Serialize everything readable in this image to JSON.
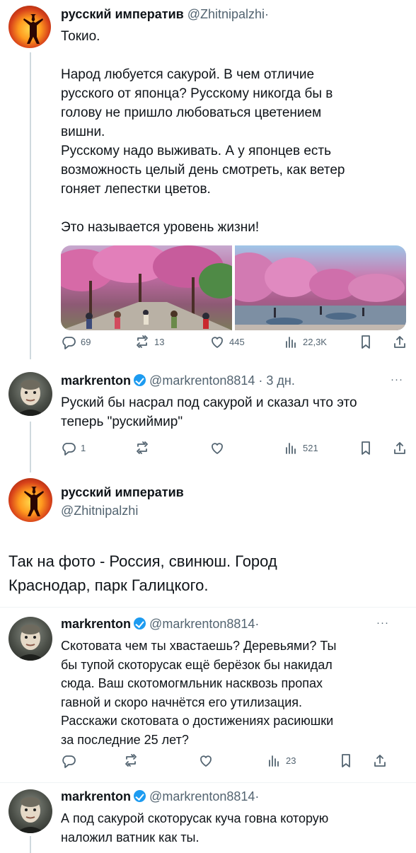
{
  "tweet1": {
    "author": "русский император",
    "author_display": "русский императив",
    "handle": "@Zhitnipalzhi",
    "dot": "·",
    "text": "Токио.\n\nНарод любуется сакурой. В чем отличие\nрусского от японца? Русскому никогда бы в\nголову не пришло любоваться цветением\nвишни.\nРусскому надо выживать. А у японцев есть\nвозможность целый день смотреть, как ветер\nгоняет лепестки цветов.\n\nЭто называется уровень жизни!",
    "replies": "69",
    "reposts": "13",
    "likes": "445",
    "views": "22,3K",
    "colors": {
      "sky": "#9fc6e8",
      "blossom": "#d77fb5"
    }
  },
  "tweet2": {
    "author": "markrenton",
    "handle": "@markrenton8814",
    "time": "· 3 дн.",
    "more": "···",
    "text": "Руский бы насрал под сакурой и сказал что это\nтеперь \"рускиймир\"",
    "replies": "1",
    "views": "521"
  },
  "tweet3": {
    "author": "русский императив",
    "handle": "@Zhitnipalzhi",
    "text": "Так на фото - Россия, свинюш. Город\nКраснодар, парк Галицкого."
  },
  "tweet4": {
    "author": "markrenton",
    "handle": "@markrenton8814",
    "dot": "·",
    "more": "···",
    "text": "Скотовата чем ты хвастаешь?  Деревьями? Ты\nбы тупой скоторусак ещё берёзок бы накидал\nсюда. Ваш скотомогмльник насквозь пропах\nгавной и скоро начнётся его утилизация.\nРасскажи скотовата о достижениях расиюшки\nза последние 25 лет?",
    "views": "23"
  },
  "tweet5": {
    "author": "markrenton",
    "handle": "@markrenton8814",
    "dot": "·",
    "text": "А под сакурой скоторусак куча говна которую\nналожил ватник как ты."
  },
  "icons": [
    "reply-icon",
    "repost-icon",
    "like-icon",
    "views-icon",
    "bookmark-icon",
    "share-icon",
    "verified-badge-icon"
  ],
  "colors": {
    "text": "#0f1419",
    "secondary": "#536471",
    "verified": "#1d9bf0",
    "thread": "#cfd9de"
  }
}
